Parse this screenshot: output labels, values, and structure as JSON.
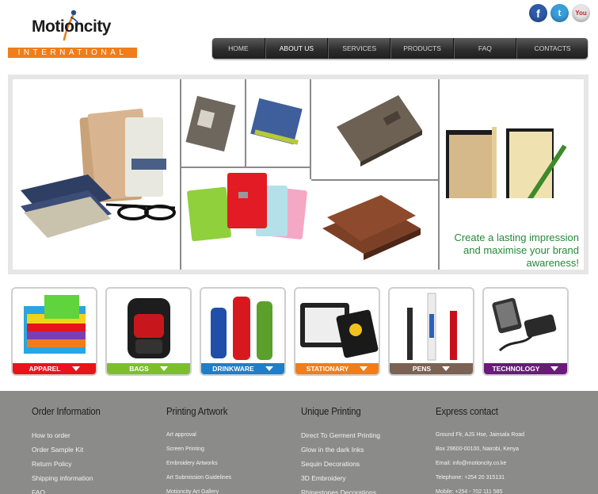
{
  "brand": {
    "name": "Motioncity",
    "tagline": "INTERNATIONAL",
    "color": "#f07d1a"
  },
  "social": [
    {
      "name": "facebook",
      "glyph": "f"
    },
    {
      "name": "twitter",
      "glyph": "t"
    },
    {
      "name": "youtube",
      "glyph": "You"
    }
  ],
  "nav": [
    {
      "label": "HOME"
    },
    {
      "label": "ABOUT US"
    },
    {
      "label": "SERVICES"
    },
    {
      "label": "PRODUCTS"
    },
    {
      "label": "FAQ"
    },
    {
      "label": "CONTACTS"
    }
  ],
  "nav_active": "ABOUT US",
  "banner": {
    "line1": "Create a lasting impression",
    "line2": "and maximise your brand",
    "line3": "awareness!"
  },
  "categories": [
    {
      "label": "APPAREL",
      "color": "#e8141b"
    },
    {
      "label": "BAGS",
      "color": "#7dbf2a"
    },
    {
      "label": "DRINKWARE",
      "color": "#1f7ec9"
    },
    {
      "label": "STATIONARY",
      "color": "#f07d1a"
    },
    {
      "label": "PENS",
      "color": "#7a6254"
    },
    {
      "label": "TECHNOLOGY",
      "color": "#6a1b7a"
    }
  ],
  "footer": {
    "order": {
      "title": "Order Information",
      "links": [
        "How to order",
        "Order Sample Kit",
        "Return Policy",
        "Shipping information",
        "FAQ"
      ]
    },
    "artwork": {
      "title": "Printing Artwork",
      "links": [
        "Art approval",
        "Screen Printing",
        "Embroidery Artworks",
        "Art Submission Guidelines",
        "Motioncity Art Gallery"
      ]
    },
    "unique": {
      "title": "Unique Printing",
      "links": [
        "Direct To Germent Printing",
        "Glow in the dark Inks",
        "Sequin Decorations",
        "3D Embroidery",
        "Rhinestones Decorations"
      ]
    },
    "contact": {
      "title": "Express contact",
      "lines": [
        "Ground Flr, AJS Hse, Jainsala Road",
        "Box 29600-00100, Nairobi, Kenya",
        "Email: info@motioncity.co.ke",
        "Telephone: +254 20 315131",
        "Mobile: +254 - 702 111 585"
      ]
    }
  }
}
